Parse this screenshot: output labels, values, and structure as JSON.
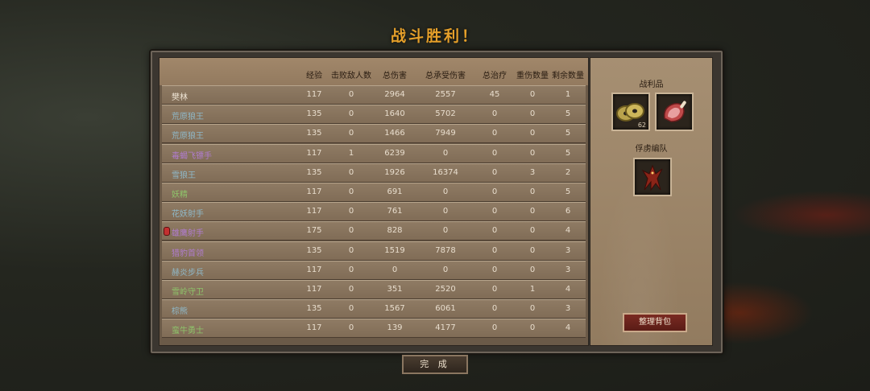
{
  "title": "战斗胜利！",
  "table": {
    "columns": [
      "经验",
      "击败敌人数",
      "总伤害",
      "总承受伤害",
      "总治疗",
      "重伤数量",
      "剩余数量"
    ],
    "rows": [
      {
        "name": "樊林",
        "color": "#eee4d4",
        "xp": "117",
        "kills": "0",
        "dmg": "2964",
        "taken": "2557",
        "heal": "45",
        "injured": "0",
        "remain": "1"
      },
      {
        "name": "荒原狼王",
        "color": "#8fb8c8",
        "xp": "135",
        "kills": "0",
        "dmg": "1640",
        "taken": "5702",
        "heal": "0",
        "injured": "0",
        "remain": "5"
      },
      {
        "name": "荒原狼王",
        "color": "#8fb8c8",
        "xp": "135",
        "kills": "0",
        "dmg": "1466",
        "taken": "7949",
        "heal": "0",
        "injured": "0",
        "remain": "5"
      },
      {
        "name": "毒蝎飞镖手",
        "color": "#b07ccf",
        "xp": "117",
        "kills": "1",
        "dmg": "6239",
        "taken": "0",
        "heal": "0",
        "injured": "0",
        "remain": "5"
      },
      {
        "name": "雪狼王",
        "color": "#8fb8c8",
        "xp": "135",
        "kills": "0",
        "dmg": "1926",
        "taken": "16374",
        "heal": "0",
        "injured": "3",
        "remain": "2"
      },
      {
        "name": "妖精",
        "color": "#8ec46a",
        "xp": "117",
        "kills": "0",
        "dmg": "691",
        "taken": "0",
        "heal": "0",
        "injured": "0",
        "remain": "5"
      },
      {
        "name": "花妖射手",
        "color": "#8fb8c8",
        "xp": "117",
        "kills": "0",
        "dmg": "761",
        "taken": "0",
        "heal": "0",
        "injured": "0",
        "remain": "6"
      },
      {
        "name": "雄鹰射手",
        "color": "#b07ccf",
        "xp": "175",
        "kills": "0",
        "dmg": "828",
        "taken": "0",
        "heal": "0",
        "injured": "0",
        "remain": "4",
        "marker": true
      },
      {
        "name": "猎豹首领",
        "color": "#b07ccf",
        "xp": "135",
        "kills": "0",
        "dmg": "1519",
        "taken": "7878",
        "heal": "0",
        "injured": "0",
        "remain": "3"
      },
      {
        "name": "赫炎步兵",
        "color": "#8fb8c8",
        "xp": "117",
        "kills": "0",
        "dmg": "0",
        "taken": "0",
        "heal": "0",
        "injured": "0",
        "remain": "3"
      },
      {
        "name": "雪岭守卫",
        "color": "#8ec46a",
        "xp": "117",
        "kills": "0",
        "dmg": "351",
        "taken": "2520",
        "heal": "0",
        "injured": "1",
        "remain": "4"
      },
      {
        "name": "棕熊",
        "color": "#8fb8c8",
        "xp": "135",
        "kills": "0",
        "dmg": "1567",
        "taken": "6061",
        "heal": "0",
        "injured": "0",
        "remain": "3"
      },
      {
        "name": "蛮牛勇士",
        "color": "#8ec46a",
        "xp": "117",
        "kills": "0",
        "dmg": "139",
        "taken": "4177",
        "heal": "0",
        "injured": "0",
        "remain": "4"
      }
    ]
  },
  "loot": {
    "label": "战利品",
    "items": [
      {
        "icon": "coins-icon",
        "count": "62"
      },
      {
        "icon": "meat-icon",
        "count": ""
      }
    ]
  },
  "captives": {
    "label": "俘虏编队",
    "items": [
      {
        "icon": "red-beast-icon"
      }
    ]
  },
  "sort_button": "整理背包",
  "done_button": "完 成"
}
